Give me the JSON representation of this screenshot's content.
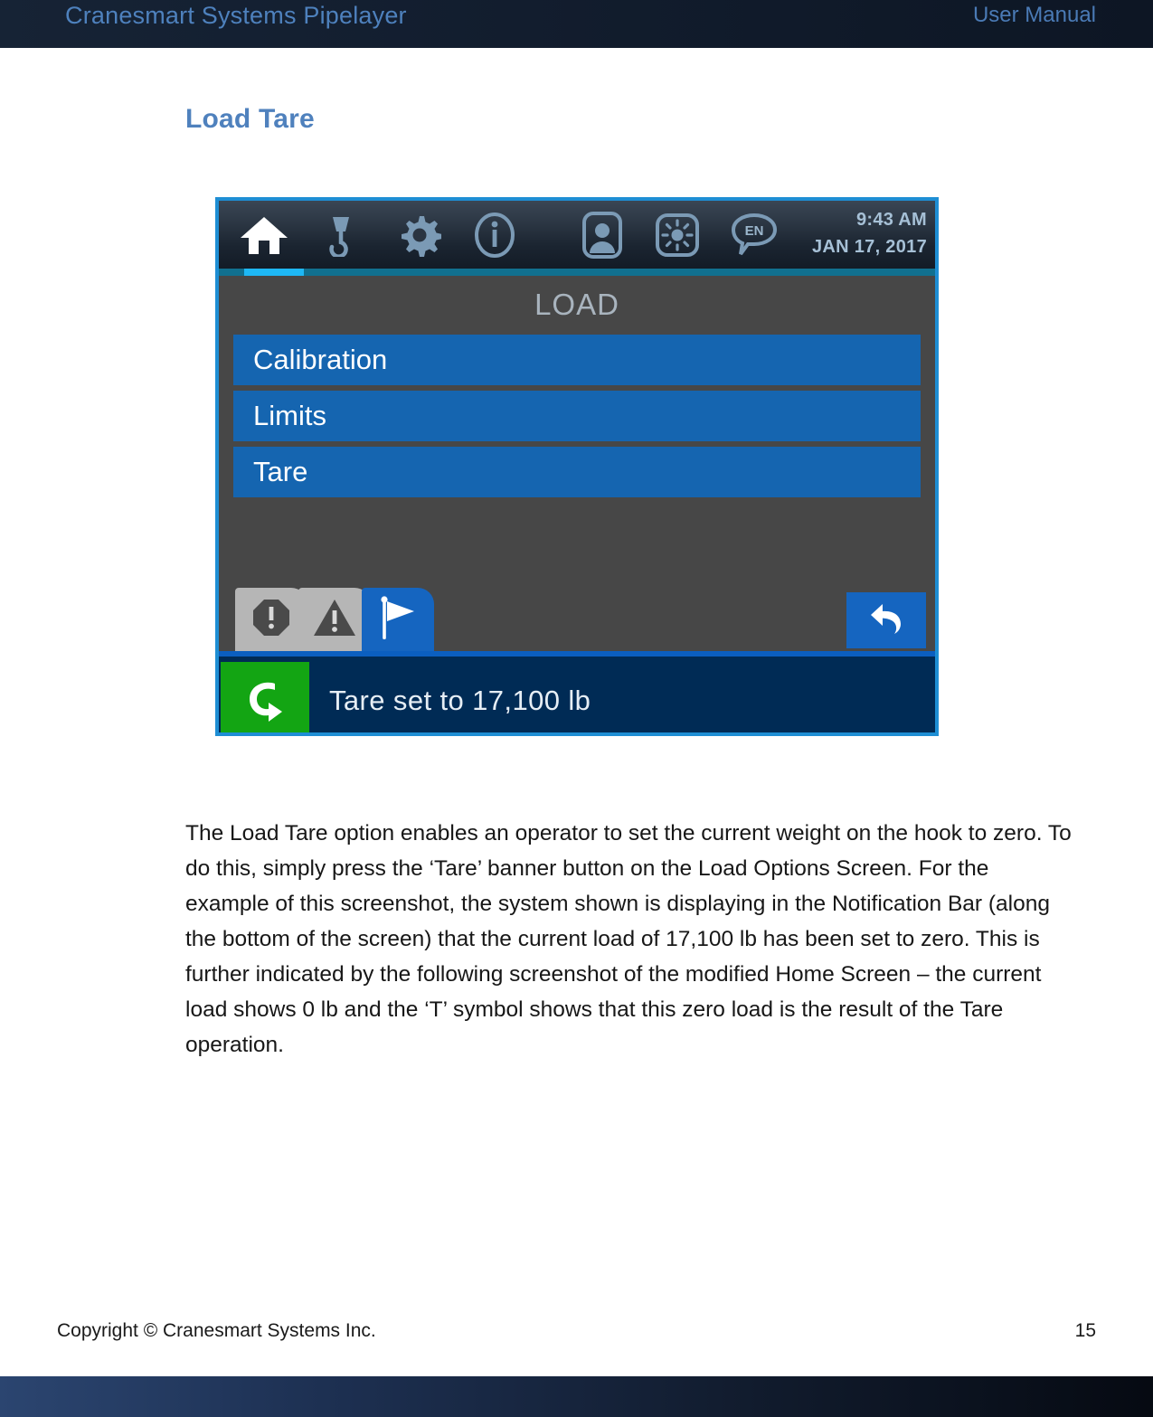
{
  "header": {
    "doc_title": "Cranesmart Systems Pipelayer",
    "doc_kind": "User Manual",
    "bg_color": "#121d2e",
    "text_color": "#4e81bd"
  },
  "section": {
    "heading": "Load Tare",
    "heading_color": "#4f81bd"
  },
  "device_screenshot": {
    "frame_color": "#1e8ed4",
    "status_bar": {
      "icons": [
        {
          "name": "home-icon",
          "label": "Home",
          "active": true
        },
        {
          "name": "hook-icon",
          "label": "Load / Hook",
          "active": false
        },
        {
          "name": "gear-icon",
          "label": "Settings",
          "active": false
        },
        {
          "name": "info-icon",
          "label": "Information",
          "active": false
        },
        {
          "name": "person-icon",
          "label": "Operator",
          "active": false
        },
        {
          "name": "brightness-icon",
          "label": "Brightness",
          "active": false
        },
        {
          "name": "language-icon",
          "label": "EN",
          "active": false
        }
      ],
      "language_code": "EN",
      "time": "9:43 AM",
      "date": "JAN 17, 2017"
    },
    "screen": {
      "title": "LOAD",
      "title_color": "#a9b4be",
      "background_color": "#474747",
      "menu_items": [
        {
          "label": "Calibration"
        },
        {
          "label": "Limits"
        },
        {
          "label": "Tare"
        }
      ],
      "menu_color": "#1565b0"
    },
    "tabs": [
      {
        "name": "alarm-stop-tab",
        "icon": "octagon-exclamation-icon",
        "active": false
      },
      {
        "name": "warning-tab",
        "icon": "triangle-exclamation-icon",
        "active": false
      },
      {
        "name": "flag-tab",
        "icon": "flag-icon",
        "active": true
      }
    ],
    "back_button": {
      "icon": "back-arrow-icon",
      "color": "#1565c0"
    },
    "notification": {
      "icon": "tare-arrow-icon",
      "icon_color": "#13a513",
      "text": "Tare set to 17,100 lb",
      "bar_color": "#002b55"
    }
  },
  "body": {
    "paragraph": "The Load Tare option enables an operator to set the current weight on the hook to zero.  To do this, simply press the ‘Tare’ banner button on the Load Options Screen.  For the example of this screenshot, the system shown is displaying in the Notification Bar (along the bottom of the screen) that the current load of 17,100 lb has been set to zero.  This is further indicated by the following screenshot of the modified Home Screen – the current load shows 0 lb and the ‘T’ symbol shows that this zero load is the result of the Tare operation."
  },
  "footer": {
    "copyright": "Copyright © Cranesmart Systems Inc.",
    "page_number": "15"
  }
}
